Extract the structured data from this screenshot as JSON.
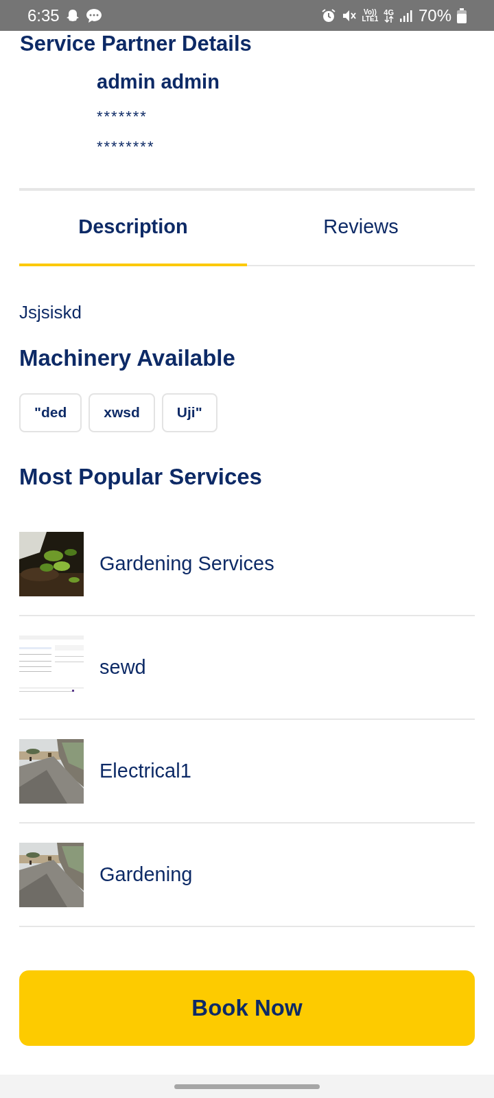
{
  "status_bar": {
    "time": "6:35",
    "volte_top": "Vo))",
    "volte_bottom": "LTE1",
    "network": "4G",
    "battery": "70%"
  },
  "header": {
    "title": "Service Partner Details"
  },
  "partner": {
    "name": "admin admin",
    "lines": [
      "*******",
      "********"
    ]
  },
  "tabs": [
    {
      "label": "Description",
      "selected": true
    },
    {
      "label": "Reviews",
      "selected": false
    }
  ],
  "description": "Jsjsiskd",
  "machinery": {
    "title": "Machinery Available",
    "chips": [
      "\"ded",
      "xwsd",
      "Uji\""
    ]
  },
  "services": {
    "title": "Most Popular Services",
    "items": [
      {
        "name": "Gardening Services",
        "kind": "picture"
      },
      {
        "name": "sewd",
        "kind": "picture"
      },
      {
        "name": "Electrical1",
        "kind": "picture"
      },
      {
        "name": "Gardening",
        "kind": "picture"
      }
    ]
  },
  "book_button": "Book Now"
}
